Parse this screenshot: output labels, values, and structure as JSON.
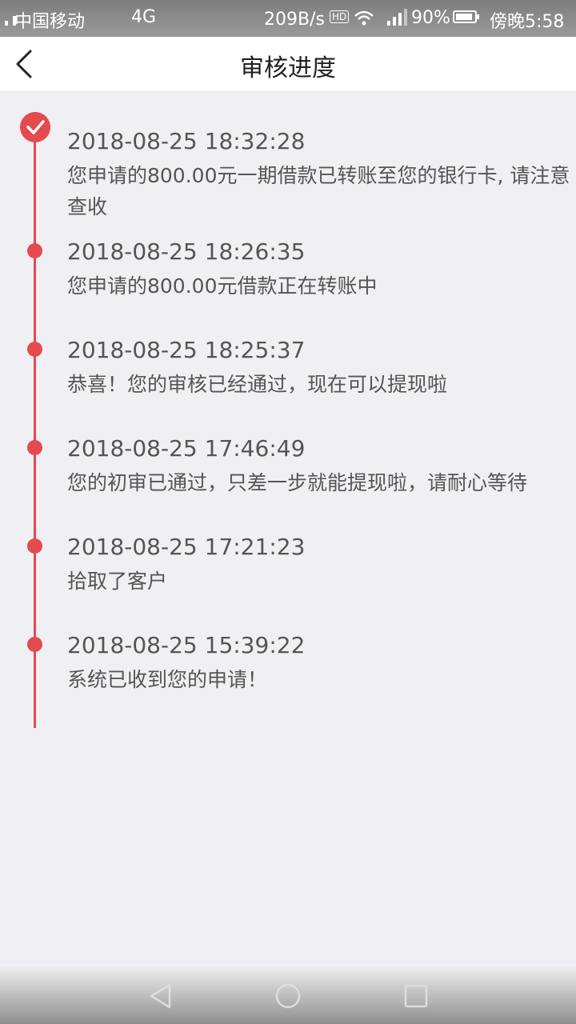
{
  "status_bar": {
    "carrier": "中国移动",
    "network": "4G",
    "clock": "17:58",
    "speed": "209B/s",
    "hd": "HD",
    "battery_pct": "90%",
    "battery_level": 0.9,
    "time_right": "傍晚5:58"
  },
  "header": {
    "title": "审核进度"
  },
  "timeline": [
    {
      "time": "2018-08-25 18:32:28",
      "text": "您申请的800.00元一期借款已转账至您的银行卡, 请注意查收",
      "current": true
    },
    {
      "time": "2018-08-25 18:26:35",
      "text": "您申请的800.00元借款正在转账中"
    },
    {
      "time": "2018-08-25 18:25:37",
      "text": "恭喜！您的审核已经通过，现在可以提现啦"
    },
    {
      "time": "2018-08-25 17:46:49",
      "text": "您的初审已通过，只差一步就能提现啦，请耐心等待"
    },
    {
      "time": "2018-08-25 17:21:23",
      "text": "拾取了客户"
    },
    {
      "time": "2018-08-25 15:39:22",
      "text": "系统已收到您的申请！"
    }
  ],
  "colors": {
    "accent": "#e34b4f",
    "background": "#f0eff4"
  },
  "icons": {
    "back": "chevron-left-icon",
    "check": "check-icon",
    "nav_back": "triangle-back-icon",
    "nav_home": "circle-home-icon",
    "nav_recent": "square-recent-icon"
  }
}
